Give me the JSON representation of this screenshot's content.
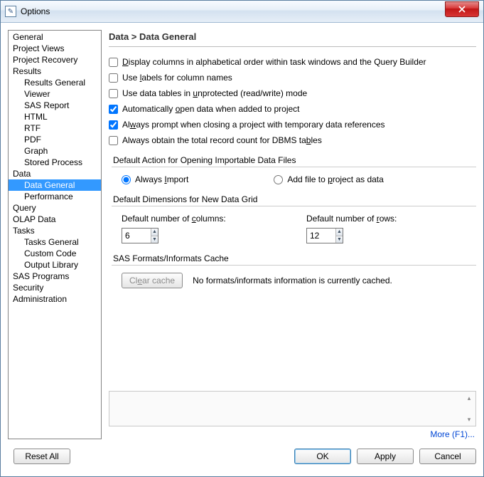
{
  "window": {
    "title": "Options"
  },
  "nav": {
    "items": [
      {
        "label": "General",
        "level": 1
      },
      {
        "label": "Project Views",
        "level": 1
      },
      {
        "label": "Project Recovery",
        "level": 1
      },
      {
        "label": "Results",
        "level": 1
      },
      {
        "label": "Results General",
        "level": 2
      },
      {
        "label": "Viewer",
        "level": 2
      },
      {
        "label": "SAS Report",
        "level": 2
      },
      {
        "label": "HTML",
        "level": 2
      },
      {
        "label": "RTF",
        "level": 2
      },
      {
        "label": "PDF",
        "level": 2
      },
      {
        "label": "Graph",
        "level": 2
      },
      {
        "label": "Stored Process",
        "level": 2
      },
      {
        "label": "Data",
        "level": 1
      },
      {
        "label": "Data General",
        "level": 2,
        "selected": true
      },
      {
        "label": "Performance",
        "level": 2
      },
      {
        "label": "Query",
        "level": 1
      },
      {
        "label": "OLAP Data",
        "level": 1
      },
      {
        "label": "Tasks",
        "level": 1
      },
      {
        "label": "Tasks General",
        "level": 2
      },
      {
        "label": "Custom Code",
        "level": 2
      },
      {
        "label": "Output Library",
        "level": 2
      },
      {
        "label": "SAS Programs",
        "level": 1
      },
      {
        "label": "Security",
        "level": 1
      },
      {
        "label": "Administration",
        "level": 1
      }
    ]
  },
  "page": {
    "title": "Data > Data General",
    "check_display_alpha": "Display columns in alphabetical order within task windows and the Query Builder",
    "check_use_labels": "Use labels for column names",
    "check_unprotected": "Use data tables in unprotected (read/write) mode",
    "check_auto_open": "Automatically open data when added to project",
    "check_prompt_close": "Always prompt when closing a project with temporary data references",
    "check_record_count": "Always obtain the total record count for DBMS tables",
    "group_default_action": "Default Action for Opening Importable Data Files",
    "radio_always_import": "Always Import",
    "radio_add_file": "Add file to project as data",
    "group_dimensions": "Default Dimensions for New Data Grid",
    "label_cols": "Default number of columns:",
    "label_rows": "Default number of rows:",
    "value_cols": "6",
    "value_rows": "12",
    "group_cache": "SAS Formats/Informats Cache",
    "btn_clear_cache": "Clear cache",
    "cache_status": "No formats/informats information is currently cached.",
    "more_link": "More (F1)..."
  },
  "footer": {
    "reset": "Reset All",
    "ok": "OK",
    "apply": "Apply",
    "cancel": "Cancel"
  },
  "state": {
    "check_display_alpha": false,
    "check_use_labels": false,
    "check_unprotected": false,
    "check_auto_open": true,
    "check_prompt_close": true,
    "check_record_count": false,
    "default_action": "import"
  }
}
